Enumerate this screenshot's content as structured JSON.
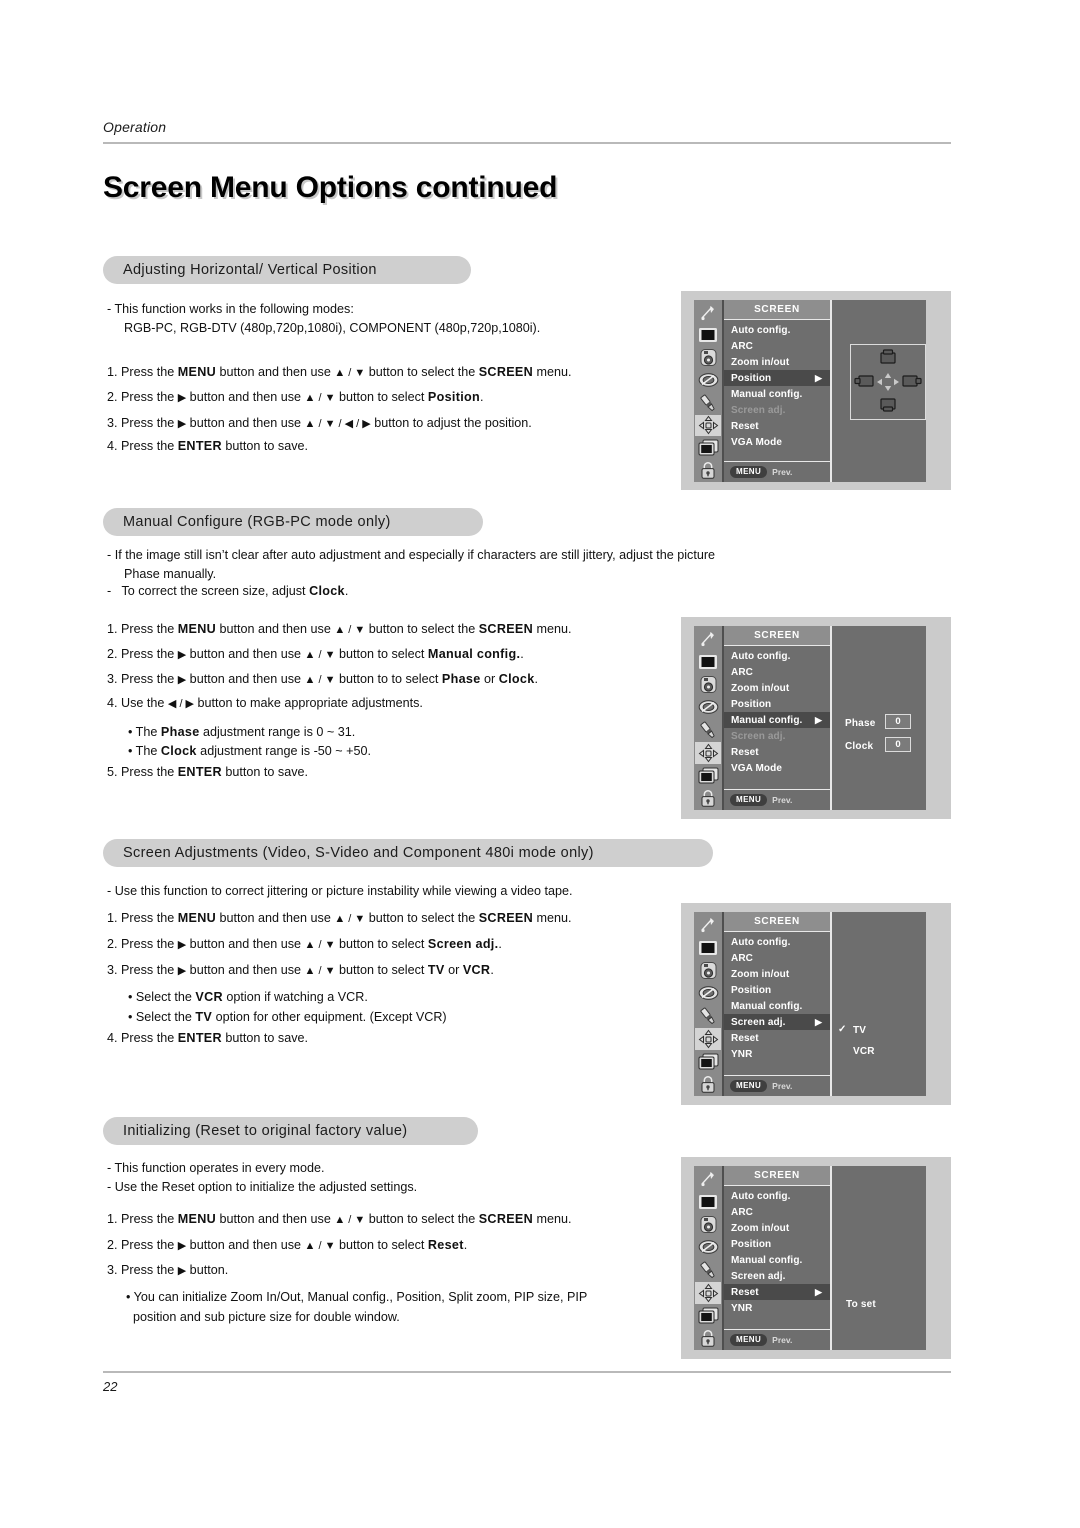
{
  "header": {
    "running_head": "Operation",
    "chapter_title": "Screen Menu Options continued"
  },
  "footer": {
    "page_number": "22"
  },
  "sections": [
    {
      "id": "position",
      "pill_label": "Adjusting Horizontal/ Vertical Position",
      "notes": [
        "-   This function works in the following modes:",
        "RGB-PC, RGB-DTV (480p,720p,1080i), COMPONENT (480p,720p,1080i)."
      ],
      "steps": [
        {
          "num": "1.",
          "pre": "Press the ",
          "b1": "MENU",
          "mid": " button and then use ",
          "keys": "▲ / ▼",
          "mid2": " button to select the ",
          "b2": "SCREEN",
          "post": " menu."
        },
        {
          "num": "2.",
          "pre": "Press the ",
          "b1": "▶",
          "mid": " button and then use ",
          "keys": "▲ / ▼",
          "mid2": " button to select ",
          "b2": "Position",
          "post": "."
        },
        {
          "num": "3.",
          "pre": "Press the ",
          "b1": "▶",
          "mid": " button and then use ",
          "keys": "▲ / ▼ / ◀ / ▶",
          "mid2": " button to adjust the position.",
          "b2": "",
          "post": ""
        },
        {
          "num": "4.",
          "pre": "Press the ",
          "b1": "ENTER",
          "mid": " button to save.",
          "keys": "",
          "mid2": "",
          "b2": "",
          "post": ""
        }
      ]
    },
    {
      "id": "manual-configure",
      "pill_label": "Manual Configure (RGB-PC mode only)",
      "notes": [
        "-   If the image still isn’t clear after auto adjustment and especially if characters are still jittery, adjust the picture",
        "Phase manually.",
        "-   To correct the screen size, adjust Clock."
      ],
      "steps": [
        {
          "num": "1.",
          "pre": "Press the ",
          "b1": "MENU",
          "mid": " button and then use ",
          "keys": "▲ / ▼",
          "mid2": " button to select the ",
          "b2": "SCREEN",
          "post": " menu."
        },
        {
          "num": "2.",
          "pre": "Press the ",
          "b1": "▶",
          "mid": " button and then use ",
          "keys": "▲ / ▼",
          "mid2": " button to select ",
          "b2": "Manual config.",
          "post": "."
        },
        {
          "num": "3.",
          "pre": "Press the ",
          "b1": "▶",
          "mid": " button and then use ",
          "keys": "▲ / ▼",
          "mid2": " button to to select ",
          "b2": "Phase",
          "post": " or "
        },
        {
          "num": "4.",
          "pre": "Use the ",
          "b1": "◀ / ▶",
          "mid": " button to make appropriate adjustments.",
          "keys": "",
          "mid2": "",
          "b2": "",
          "post": ""
        },
        {
          "num": "5.",
          "pre": "Press the ",
          "b1": "ENTER",
          "mid": " button to save.",
          "keys": "",
          "mid2": "",
          "b2": "",
          "post": ""
        }
      ],
      "bullets": [
        {
          "pre": "• The ",
          "b": "Phase",
          "post": " adjustment range is 0 ~ 31."
        },
        {
          "pre": "• The ",
          "b": "Clock",
          "post": " adjustment range is -50 ~ +50."
        }
      ]
    },
    {
      "id": "screen-adjustments",
      "pill_label": "Screen Adjustments (Video, S-Video and Component 480i mode only)",
      "notes": [
        "-   Use this function to correct jittering or picture instability while viewing a video tape."
      ],
      "steps": [
        {
          "num": "1.",
          "pre": "Press the ",
          "b1": "MENU",
          "mid": " button and then use ",
          "keys": "▲ / ▼",
          "mid2": " button to select the ",
          "b2": "SCREEN",
          "post": " menu."
        },
        {
          "num": "2.",
          "pre": "Press the ",
          "b1": "▶",
          "mid": " button and then use ",
          "keys": "▲ / ▼",
          "mid2": " button to select ",
          "b2": "Screen adj.",
          "post": ""
        },
        {
          "num": "3.",
          "pre": "Press the ",
          "b1": "▶",
          "mid": " button and then use ",
          "keys": "▲ / ▼",
          "mid2": " button to select ",
          "b2": "TV",
          "post": " or "
        },
        {
          "num": "4.",
          "pre": "Press the ",
          "b1": "ENTER",
          "mid": " button to save.",
          "keys": "",
          "mid2": "",
          "b2": "",
          "post": ""
        }
      ],
      "bullets": [
        {
          "pre": "• Select the ",
          "b": "VCR",
          "post": " option if watching a VCR."
        },
        {
          "pre": "• Select the ",
          "b": "TV",
          "post": " option for other equipment. (Except VCR)"
        }
      ]
    },
    {
      "id": "initializing",
      "pill_label": "Initializing (Reset to original factory value)",
      "notes": [
        "-   This function operates in every mode.",
        "-   Use the Reset option to initialize the adjusted settings."
      ],
      "steps": [
        {
          "num": "1.",
          "pre": "Press the ",
          "b1": "MENU",
          "mid": " button and then use ",
          "keys": "▲ / ▼",
          "mid2": " button to select the ",
          "b2": "SCREEN",
          "post": " menu."
        },
        {
          "num": "2.",
          "pre": "Press the ",
          "b1": "▶",
          "mid": " button and then use ",
          "keys": "▲ / ▼",
          "mid2": " button to select ",
          "b2": "Reset",
          "post": "."
        },
        {
          "num": "3.",
          "pre": "Press the ",
          "b1": "▶",
          "mid": " button.",
          "keys": "",
          "mid2": "",
          "b2": "",
          "post": ""
        }
      ],
      "bullets": [
        {
          "pre": "• You can initialize Zoom In/Out, Manual config., Position, Split zoom, PIP size, PIP",
          "b": "",
          "post": ""
        },
        {
          "pre": "position and sub picture size for double window.",
          "b": "",
          "post": ""
        }
      ]
    }
  ],
  "inline": {
    "clock_word": "Clock",
    "period": ".",
    "or_word": " or ",
    "clock_bold": "Clock",
    "vcr_bold": "VCR"
  },
  "osd": {
    "title": "SCREEN",
    "footer_menu": "MENU",
    "footer_prev": "Prev.",
    "rail_icons": [
      "antenna-icon",
      "picture-icon",
      "sound-icon",
      "timer-icon",
      "special-icon",
      "screen-icon",
      "pip-icon",
      "lock-icon"
    ],
    "figures": [
      {
        "id": "osd-position",
        "items": [
          {
            "label": "Auto config.",
            "state": "normal",
            "arrow": false
          },
          {
            "label": "ARC",
            "state": "normal",
            "arrow": false
          },
          {
            "label": "Zoom in/out",
            "state": "normal",
            "arrow": false
          },
          {
            "label": "Position",
            "state": "selected",
            "arrow": true
          },
          {
            "label": "Manual config.",
            "state": "normal",
            "arrow": false
          },
          {
            "label": "Screen adj.",
            "state": "disabled",
            "arrow": false
          },
          {
            "label": "Reset",
            "state": "normal",
            "arrow": false
          },
          {
            "label": "VGA Mode",
            "state": "normal",
            "arrow": false
          }
        ],
        "pane": {
          "type": "position-diagram"
        }
      },
      {
        "id": "osd-manual-config",
        "items": [
          {
            "label": "Auto config.",
            "state": "normal",
            "arrow": false
          },
          {
            "label": "ARC",
            "state": "normal",
            "arrow": false
          },
          {
            "label": "Zoom in/out",
            "state": "normal",
            "arrow": false
          },
          {
            "label": "Position",
            "state": "normal",
            "arrow": false
          },
          {
            "label": "Manual config.",
            "state": "selected",
            "arrow": true
          },
          {
            "label": "Screen adj.",
            "state": "disabled",
            "arrow": false
          },
          {
            "label": "Reset",
            "state": "normal",
            "arrow": false
          },
          {
            "label": "VGA Mode",
            "state": "normal",
            "arrow": false
          }
        ],
        "pane": {
          "type": "values",
          "rows": [
            {
              "label": "Phase",
              "value": "0"
            },
            {
              "label": "Clock",
              "value": "0"
            }
          ]
        }
      },
      {
        "id": "osd-screen-adj",
        "items": [
          {
            "label": "Auto config.",
            "state": "normal",
            "arrow": false
          },
          {
            "label": "ARC",
            "state": "normal",
            "arrow": false
          },
          {
            "label": "Zoom in/out",
            "state": "normal",
            "arrow": false
          },
          {
            "label": "Position",
            "state": "normal",
            "arrow": false
          },
          {
            "label": "Manual config.",
            "state": "normal",
            "arrow": false
          },
          {
            "label": "Screen adj.",
            "state": "selected",
            "arrow": true
          },
          {
            "label": "Reset",
            "state": "normal",
            "arrow": false
          },
          {
            "label": "YNR",
            "state": "normal",
            "arrow": false
          }
        ],
        "pane": {
          "type": "options",
          "options": [
            {
              "label": "TV",
              "checked": true
            },
            {
              "label": "VCR",
              "checked": false
            }
          ],
          "check_glyph": "✓"
        }
      },
      {
        "id": "osd-reset",
        "items": [
          {
            "label": "Auto config.",
            "state": "normal",
            "arrow": false
          },
          {
            "label": "ARC",
            "state": "normal",
            "arrow": false
          },
          {
            "label": "Zoom in/out",
            "state": "normal",
            "arrow": false
          },
          {
            "label": "Position",
            "state": "normal",
            "arrow": false
          },
          {
            "label": "Manual config.",
            "state": "normal",
            "arrow": false
          },
          {
            "label": "Screen adj.",
            "state": "normal",
            "arrow": false
          },
          {
            "label": "Reset",
            "state": "selected",
            "arrow": true
          },
          {
            "label": "YNR",
            "state": "normal",
            "arrow": false
          }
        ],
        "pane": {
          "type": "text",
          "text": "To set"
        }
      }
    ]
  },
  "colors": {
    "pill_bg": "#cfcfcf",
    "rule": "#b9b9b9",
    "osd_fig_bg": "#cbcbcb",
    "osd_body": "#6e6e6e",
    "osd_rail": "#8a8a8a",
    "osd_selected": "#4a4a4a",
    "osd_title_bg": "#8e8e8e",
    "osd_disabled_text": "#9a9a9a"
  }
}
